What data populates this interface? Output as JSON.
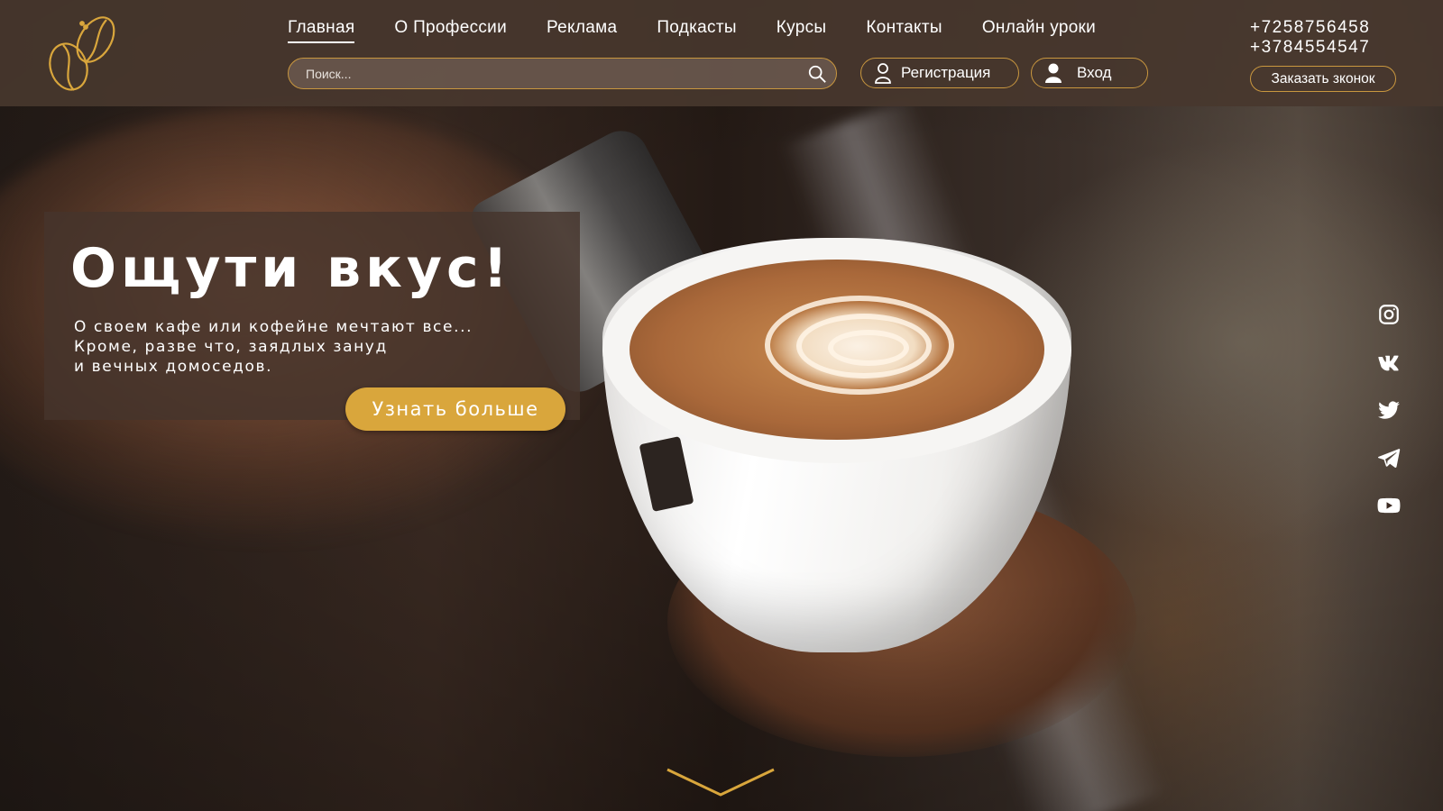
{
  "nav": {
    "items": [
      {
        "label": "Главная",
        "active": true
      },
      {
        "label": "О Профессии"
      },
      {
        "label": "Реклама"
      },
      {
        "label": "Подкасты"
      },
      {
        "label": "Курсы"
      },
      {
        "label": "Контакты"
      },
      {
        "label": "Онлайн уроки"
      }
    ]
  },
  "search": {
    "placeholder": "Поиск...",
    "icon": "search-icon"
  },
  "auth": {
    "register_label": "Регистрация",
    "register_icon": "user-outline-icon",
    "login_label": "Вход",
    "login_icon": "user-filled-icon"
  },
  "contacts": {
    "phone_1": "+7258756458",
    "phone_2": "+3784554547",
    "callback_label": "Заказать зконок"
  },
  "hero": {
    "title": "Ощути вкус!",
    "text": "О своем кафе или кофейне мечтают все...\nКроме, разве что, заядлых зануд\nи вечных домоседов.",
    "cta_label": "Узнать больше"
  },
  "socials": [
    "instagram-icon",
    "vk-icon",
    "twitter-icon",
    "telegram-icon",
    "youtube-icon"
  ],
  "colors": {
    "accent": "#d9a63c",
    "outline": "#c9973f",
    "header_bg": "#48372e"
  }
}
